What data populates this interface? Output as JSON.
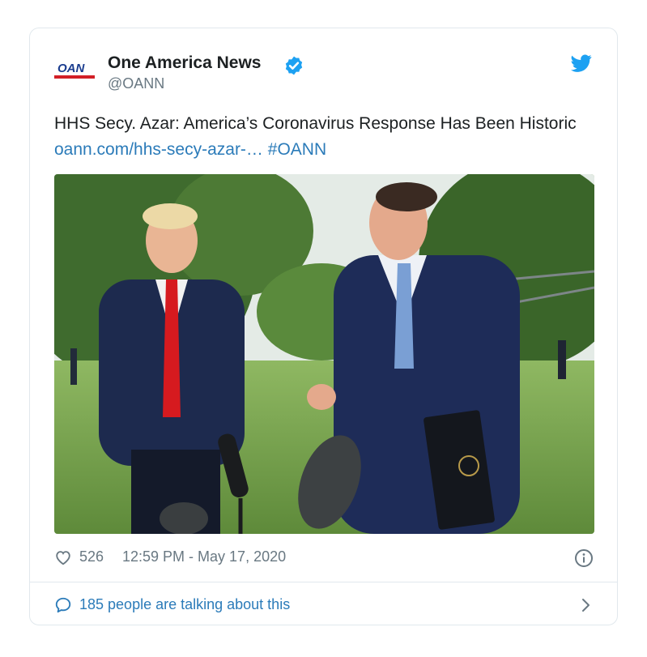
{
  "account": {
    "logo_text": "OAN",
    "display_name": "One America News",
    "handle": "@OANN"
  },
  "tweet": {
    "text": "HHS Secy. Azar: America’s Coronavirus Response Has Been Historic",
    "link": "oann.com/hhs-secy-azar-…",
    "hashtag": "#OANN"
  },
  "footer": {
    "likes": "526",
    "timestamp": "12:59 PM - May 17, 2020",
    "talking": "185 people are talking about this"
  },
  "colors": {
    "link": "#2b7bb9",
    "verified": "#1da1f2",
    "muted": "#697882"
  },
  "icons": [
    "verified-badge-icon",
    "twitter-bird-icon",
    "heart-icon",
    "info-icon",
    "speech-bubble-icon",
    "chevron-right-icon"
  ]
}
